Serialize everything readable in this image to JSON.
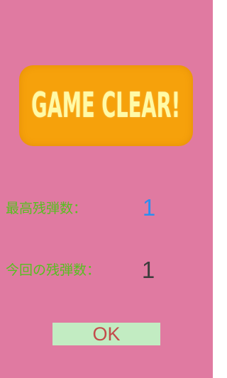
{
  "banner": {
    "text": "GAME CLEAR!"
  },
  "stats": {
    "best_label": "最高残弾数：",
    "best_value": "1",
    "current_label": "今回の残弾数：",
    "current_value": "1"
  },
  "ok_button": {
    "label": "OK"
  },
  "colors": {
    "background": "#e07aa1",
    "banner_fill": "#f6a10b",
    "banner_text": "#fffaa6",
    "label_green": "#55c11e",
    "best_value_blue": "#2c8ef0",
    "current_value": "#3c3c3c",
    "ok_button_fill": "#c2ecc2",
    "ok_label": "#c44b4b"
  }
}
